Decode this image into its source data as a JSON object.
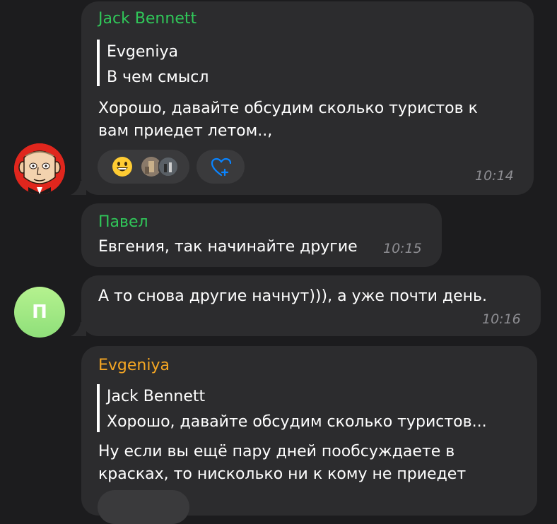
{
  "colors": {
    "background": "#1c1c1e",
    "bubble": "#2c2c2e",
    "name_green": "#30c759",
    "name_orange": "#f5a623",
    "link_blue": "#0a84ff",
    "time_gray": "#8e8e93"
  },
  "messages": [
    {
      "sender": "Jack Bennett",
      "sender_color": "green",
      "reply_to": {
        "sender": "Evgeniya",
        "text": "В чем смысл"
      },
      "text_line1": "Хорошо, давайте обсудим сколько туристов к",
      "text_line2": "вам приедет летом..,",
      "reactions": [
        {
          "icon": "grinning-face-emoji"
        },
        {
          "icon": "reactor-avatars"
        },
        {
          "icon": "add-reaction-heart-icon"
        }
      ],
      "time": "10:14"
    },
    {
      "sender": "Павел",
      "sender_color": "green",
      "text": "Евгения, так начинайте другие",
      "time": "10:15"
    },
    {
      "avatar_letter": "П",
      "text": "А то снова другие начнут))), а уже почти день.",
      "time": "10:16"
    },
    {
      "sender": "Evgeniya",
      "sender_color": "orange",
      "reply_to": {
        "sender": "Jack Bennett",
        "text": "Хорошо, давайте обсудим сколько туристов..."
      },
      "text_line1": "Ну если вы ещё пару дней пообсуждаете в",
      "text_line2": "красках, то нисколько ни к кому не приедет"
    }
  ]
}
